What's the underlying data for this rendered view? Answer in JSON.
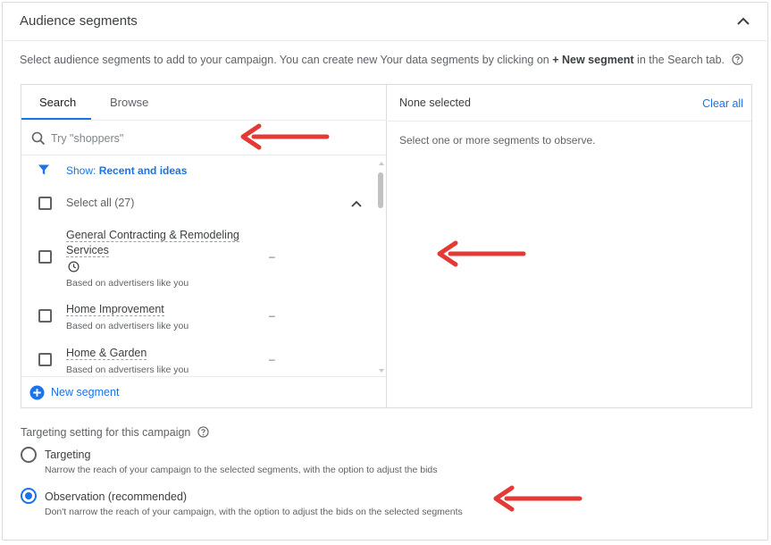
{
  "header": {
    "title": "Audience segments"
  },
  "intro": {
    "text_before": "Select audience segments to add to your campaign. You can create new Your data segments by clicking on ",
    "bold": "+ New segment",
    "text_after": " in the Search tab."
  },
  "picker": {
    "tabs": [
      {
        "label": "Search",
        "active": true
      },
      {
        "label": "Browse",
        "active": false
      }
    ],
    "search": {
      "placeholder": "Try \"shoppers\"",
      "value": ""
    },
    "show": {
      "label": "Show: ",
      "value": "Recent and ideas"
    },
    "select_all": {
      "label": "Select all (27)"
    },
    "segments": [
      {
        "name_line1": "General Contracting & Remodeling",
        "name_line2": "Services",
        "has_clock": true,
        "sub": "Based on advertisers like you",
        "value": "–"
      },
      {
        "name_line1": "Home Improvement",
        "sub": "Based on advertisers like you",
        "value": "–"
      },
      {
        "name_line1": "Home & Garden",
        "sub": "Based on advertisers like you",
        "value": "–"
      }
    ],
    "new_segment": {
      "label": "New segment"
    },
    "selected": {
      "title": "None selected",
      "clear_all": "Clear all",
      "empty_message": "Select one or more segments to observe."
    }
  },
  "targeting": {
    "title": "Targeting setting for this campaign",
    "options": [
      {
        "label": "Targeting",
        "description": "Narrow the reach of your campaign to the selected segments, with the option to adjust the bids",
        "selected": false
      },
      {
        "label": "Observation (recommended)",
        "description": "Don't narrow the reach of your campaign, with the option to adjust the bids on the selected segments",
        "selected": true
      }
    ]
  },
  "colors": {
    "accent": "#1a73e8",
    "annotation_arrow": "#e53935",
    "text": "#3c4043",
    "muted": "#5f6368",
    "border": "#dadce0"
  },
  "icons": [
    "chevron-up-icon",
    "help-circle-icon",
    "search-icon",
    "filter-icon",
    "clock-icon",
    "add-circle-icon",
    "annotation-arrow"
  ]
}
